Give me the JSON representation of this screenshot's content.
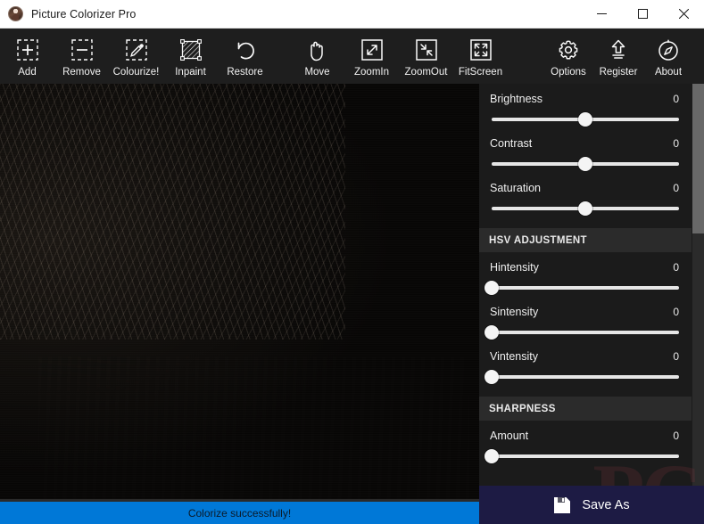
{
  "window": {
    "title": "Picture Colorizer Pro",
    "app_icon": "portrait-app-icon",
    "minimize_label": "Minimize",
    "maximize_label": "Maximize",
    "close_label": "Close"
  },
  "toolbar": {
    "left_group": [
      {
        "label": "Add",
        "icon": "plus-in-dashed-box-icon"
      },
      {
        "label": "Remove",
        "icon": "minus-in-dashed-box-icon"
      },
      {
        "label": "Colourize!",
        "icon": "eyedropper-in-dashed-box-icon"
      },
      {
        "label": "Inpaint",
        "icon": "hatched-selection-icon"
      },
      {
        "label": "Restore",
        "icon": "undo-arrow-icon"
      }
    ],
    "mid_group": [
      {
        "label": "Move",
        "icon": "hand-icon"
      },
      {
        "label": "ZoomIn",
        "icon": "zoom-in-icon"
      },
      {
        "label": "ZoomOut",
        "icon": "zoom-out-icon"
      },
      {
        "label": "FitScreen",
        "icon": "fit-screen-icon"
      }
    ],
    "right_group": [
      {
        "label": "Options",
        "icon": "gear-icon"
      },
      {
        "label": "Register",
        "icon": "upload-arrow-icon"
      },
      {
        "label": "About",
        "icon": "compass-icon"
      }
    ]
  },
  "panel": {
    "basic": {
      "controls": [
        {
          "label": "Brightness",
          "value": "0",
          "percent": 50
        },
        {
          "label": "Contrast",
          "value": "0",
          "percent": 50
        },
        {
          "label": "Saturation",
          "value": "0",
          "percent": 50
        }
      ]
    },
    "hsv": {
      "header": "HSV ADJUSTMENT",
      "controls": [
        {
          "label": "Hintensity",
          "value": "0",
          "percent": 1
        },
        {
          "label": "Sintensity",
          "value": "0",
          "percent": 1
        },
        {
          "label": "Vintensity",
          "value": "0",
          "percent": 1
        }
      ]
    },
    "sharpness": {
      "header": "SHARPNESS",
      "controls": [
        {
          "label": "Amount",
          "value": "0",
          "percent": 1
        }
      ]
    },
    "watermark": "PC",
    "save": {
      "label": "Save As",
      "icon": "floppy-disk-icon"
    }
  },
  "status": {
    "message": "Colorize successfully!"
  },
  "colors": {
    "accent_status": "#0078d7",
    "save_button": "#1d1b44",
    "toolbar_bg": "#1e1e1e",
    "panel_bg": "#1b1b1b",
    "section_header_bg": "#2b2b2b",
    "titlebar_bg": "#ffffff"
  }
}
